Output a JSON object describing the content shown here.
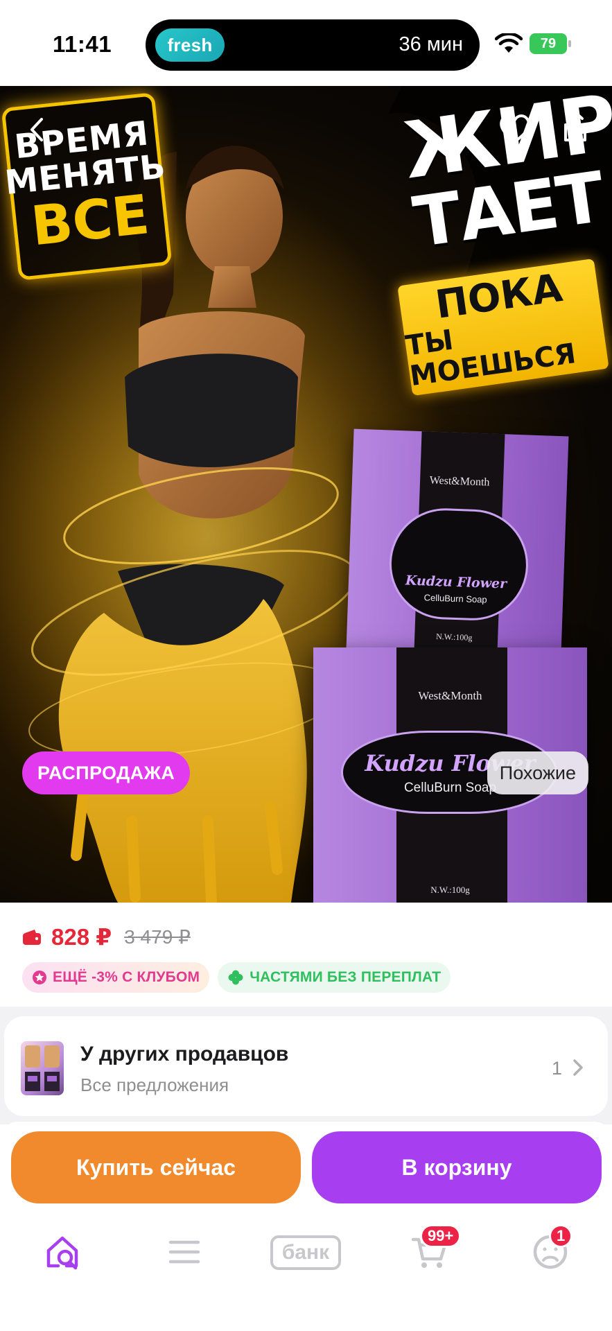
{
  "status_bar": {
    "time": "11:41",
    "island_app": "fresh",
    "island_time": "36 мин",
    "battery": "79"
  },
  "hero": {
    "left_sign": [
      "ВРЕМЯ",
      "МЕНЯТЬ",
      "ВСЕ"
    ],
    "right_title": [
      "ЖИР",
      "ТАЕТ"
    ],
    "right_ribbon": [
      "ПОКА",
      "ТЫ МОЕШЬСЯ"
    ],
    "box_small": {
      "brand": "West&Month",
      "title": "Kudzu Flower",
      "subtitle": "CelluBurn Soap",
      "weight": "N.W.:100g"
    },
    "box_large": {
      "brand": "West&Month",
      "title": "Kudzu Flower",
      "subtitle": "CelluBurn Soap",
      "weight": "N.W.:100g"
    },
    "sale_badge": "РАСПРОДАЖА",
    "similar_button": "Похожие",
    "icons": [
      "back-icon",
      "heart-icon",
      "share-icon"
    ]
  },
  "price": {
    "current": "828 ₽",
    "old": "3 479 ₽",
    "chips": [
      {
        "label": "ЕЩЁ -3% С КЛУБОМ",
        "icon": "club-star-icon"
      },
      {
        "label": "ЧАСТЯМИ БЕЗ ПЕРЕПЛАТ",
        "icon": "clover-icon"
      }
    ]
  },
  "sellers": {
    "title": "У других продавцов",
    "subtitle": "Все предложения",
    "count": "1"
  },
  "actions": {
    "buy_now": "Купить сейчас",
    "add_to_cart": "В корзину"
  },
  "tab_bar": {
    "bank_label": "банк",
    "cart_badge": "99+",
    "profile_badge": "1",
    "icons": [
      "home-search-icon",
      "catalog-menu-icon",
      "bank-icon",
      "cart-icon",
      "profile-icon"
    ]
  },
  "colors": {
    "price_red": "#e5273a",
    "sale_pink": "#e23bef",
    "buy_orange": "#f08a2c",
    "cart_purple": "#a73ff0",
    "active_tab": "#a73ff0"
  }
}
